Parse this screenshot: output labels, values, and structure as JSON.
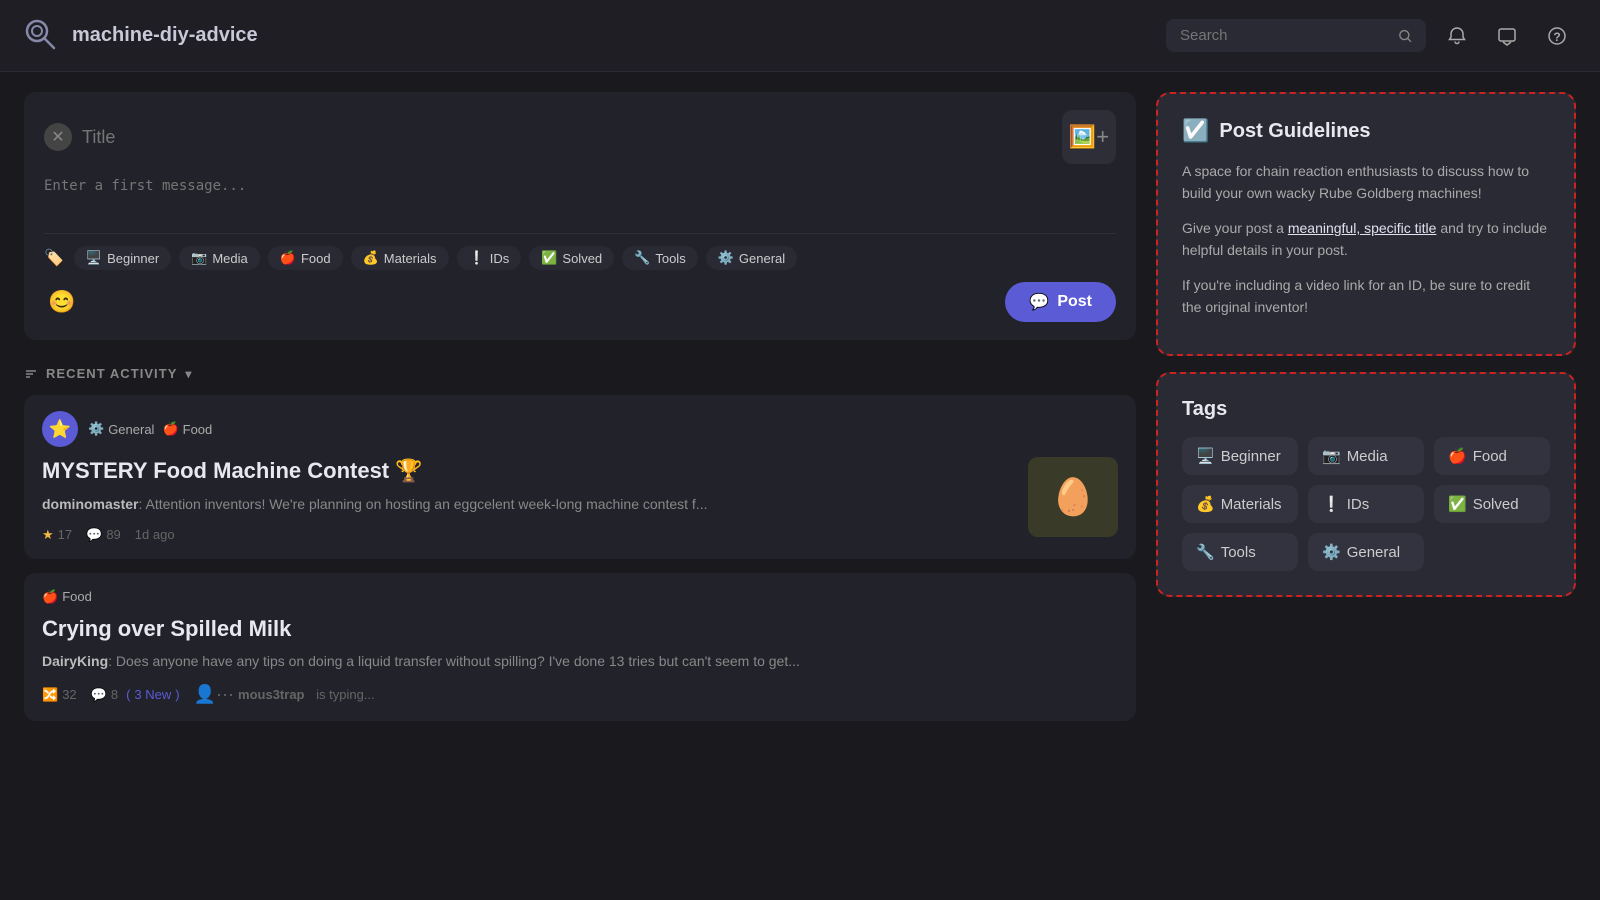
{
  "header": {
    "channel_name": "machine-diy-advice",
    "search_placeholder": "Search",
    "logo_icon": "💬"
  },
  "compose": {
    "title_placeholder": "Title",
    "message_placeholder": "Enter a first message...",
    "close_label": "✕",
    "post_label": "Post",
    "tags": [
      {
        "emoji": "🖥️",
        "label": "Beginner"
      },
      {
        "emoji": "📷",
        "label": "Media"
      },
      {
        "emoji": "🍎",
        "label": "Food"
      },
      {
        "emoji": "💰",
        "label": "Materials"
      },
      {
        "emoji": "❕",
        "label": "IDs"
      },
      {
        "emoji": "✅",
        "label": "Solved"
      },
      {
        "emoji": "🔧",
        "label": "Tools"
      },
      {
        "emoji": "⚙️",
        "label": "General"
      }
    ]
  },
  "recent_activity": {
    "label": "RECENT ACTIVITY"
  },
  "posts": [
    {
      "id": "post1",
      "avatar_emoji": "⭐",
      "tags": [
        {
          "emoji": "⚙️",
          "label": "General"
        },
        {
          "emoji": "🍎",
          "label": "Food"
        }
      ],
      "title": "MYSTERY Food Machine Contest 🏆",
      "author": "dominomaster",
      "excerpt": "Attention inventors! We're planning on hosting an eggcelent week-long machine contest f...",
      "stars": "17",
      "comments": "89",
      "time_ago": "1d ago",
      "thumbnail_emoji": "🥚"
    },
    {
      "id": "post2",
      "tag": {
        "emoji": "🍎",
        "label": "Food"
      },
      "title": "Crying over Spilled Milk",
      "author": "DairyKing",
      "excerpt": "Does anyone have any tips on doing a liquid transfer without spilling? I've done 13 tries but can't seem to get...",
      "forks": "32",
      "comments": "8",
      "new_comments": "3 New",
      "typing": "mous3trap",
      "typing_suffix": "is typing..."
    }
  ],
  "guidelines": {
    "title": "Post Guidelines",
    "paragraphs": [
      "A space for chain reaction enthusiasts to discuss how to build your own wacky Rube Goldberg machines!",
      "Give your post a meaningful, specific title and try to include helpful details in your post.",
      "If you're including a video link for an ID, be sure to credit the original inventor!"
    ],
    "link_text": "meaningful, specific title"
  },
  "tags_section": {
    "title": "Tags",
    "tags": [
      {
        "emoji": "🖥️",
        "label": "Beginner"
      },
      {
        "emoji": "📷",
        "label": "Media"
      },
      {
        "emoji": "🍎",
        "label": "Food"
      },
      {
        "emoji": "💰",
        "label": "Materials"
      },
      {
        "emoji": "❕",
        "label": "IDs"
      },
      {
        "emoji": "✅",
        "label": "Solved"
      },
      {
        "emoji": "🔧",
        "label": "Tools"
      },
      {
        "emoji": "⚙️",
        "label": "General"
      }
    ]
  }
}
